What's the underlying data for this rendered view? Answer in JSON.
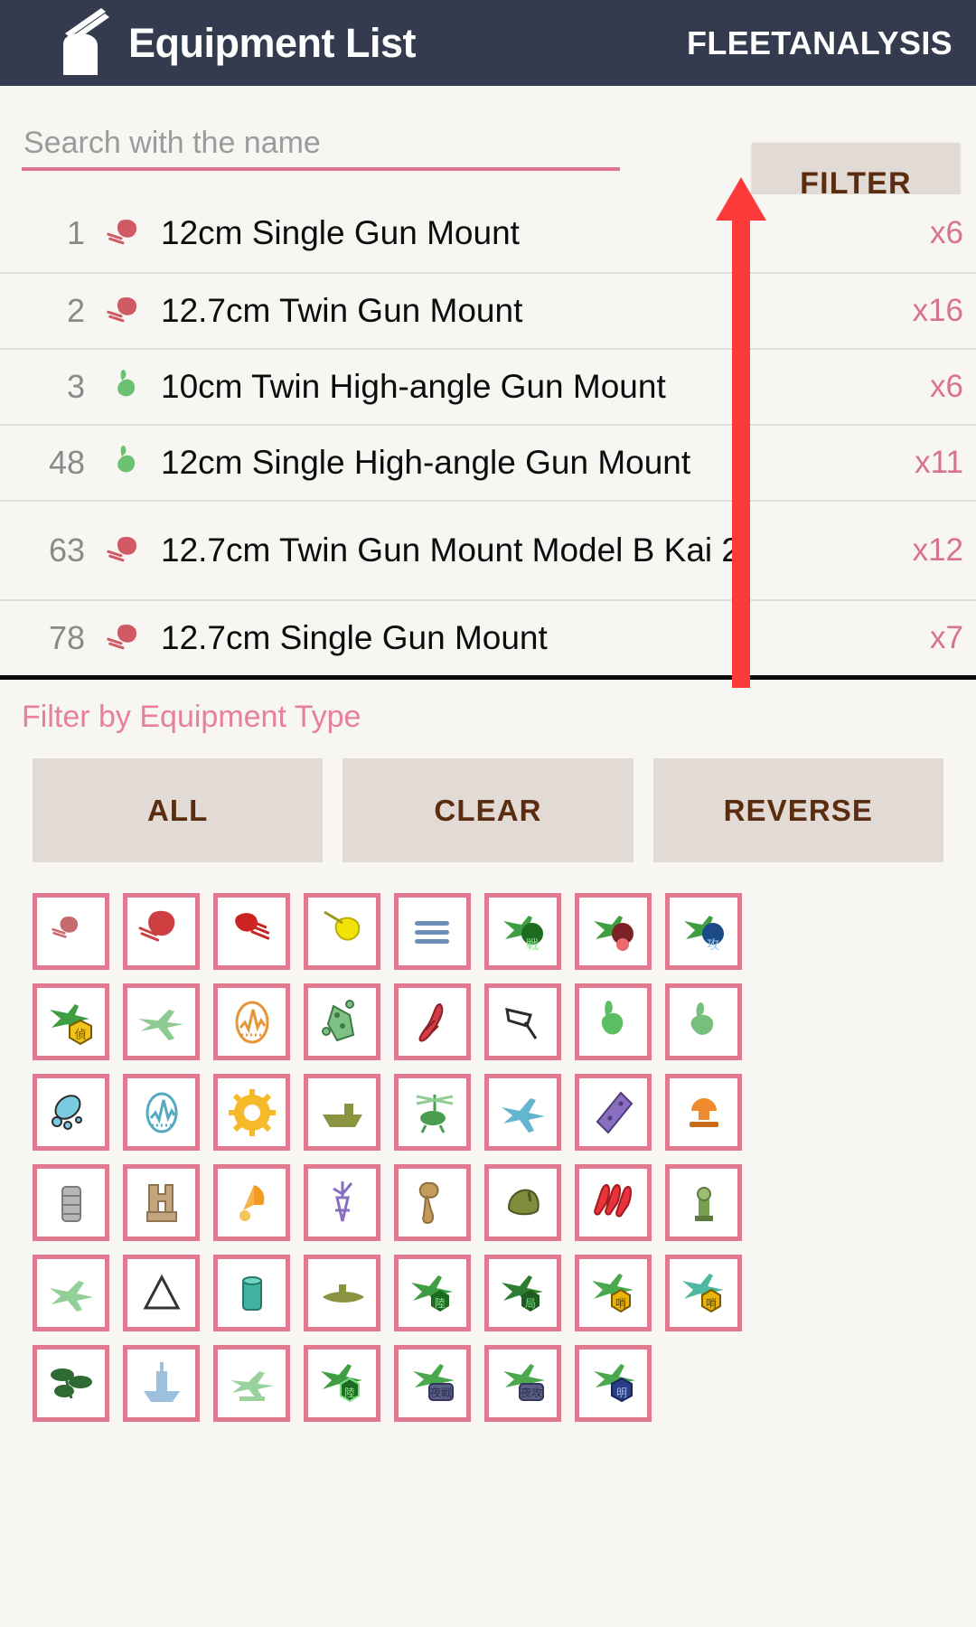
{
  "appbar": {
    "title": "Equipment List",
    "brand": "FLEETANALYSIS",
    "logo_icon": "gun-mount-icon",
    "bg_color": "#353b4e"
  },
  "search": {
    "placeholder": "Search with the name",
    "value": "",
    "underline_color": "#e0758f"
  },
  "filter_button": {
    "label": "FILTER",
    "bg_color": "#e2dad4",
    "text_color": "#5a2d10"
  },
  "equipment_list": {
    "columns": [
      "id",
      "icon",
      "name",
      "count"
    ],
    "rows": [
      {
        "id": "1",
        "icon": "red-small-gun-mount-icon",
        "name": "12cm Single Gun Mount",
        "count": "x6"
      },
      {
        "id": "2",
        "icon": "red-small-gun-mount-icon",
        "name": "12.7cm Twin Gun Mount",
        "count": "x16"
      },
      {
        "id": "3",
        "icon": "green-high-angle-gun-icon",
        "name": "10cm Twin High-angle Gun Mount",
        "count": "x6"
      },
      {
        "id": "48",
        "icon": "green-high-angle-gun-icon",
        "name": "12cm Single High-angle Gun Mount",
        "count": "x11"
      },
      {
        "id": "63",
        "icon": "red-small-gun-mount-icon",
        "name": "12.7cm Twin Gun Mount Model B Kai 2",
        "count": "x12"
      },
      {
        "id": "78",
        "icon": "red-small-gun-mount-icon",
        "name": "12.7cm Single Gun Mount",
        "count": "x7"
      }
    ],
    "count_color": "#d9738c",
    "id_color": "#8a8a8a"
  },
  "filter_panel": {
    "heading": "Filter by Equipment Type",
    "heading_color": "#e8809a",
    "actions": [
      {
        "label": "ALL",
        "name": "select-all-types-button"
      },
      {
        "label": "CLEAR",
        "name": "clear-types-button"
      },
      {
        "label": "REVERSE",
        "name": "reverse-types-button"
      }
    ],
    "cell_border_color": "#e0798f",
    "types": [
      {
        "icon": "small-caliber-main-gun-icon"
      },
      {
        "icon": "medium-caliber-main-gun-icon"
      },
      {
        "icon": "large-caliber-main-gun-icon"
      },
      {
        "icon": "yellow-secondary-gun-icon"
      },
      {
        "icon": "blue-ammo-stack-icon"
      },
      {
        "icon": "green-carrier-fighter-icon"
      },
      {
        "icon": "red-carrier-dive-bomber-icon"
      },
      {
        "icon": "blue-carrier-torpedo-bomber-icon"
      },
      {
        "icon": "yellow-recon-seaplane-icon"
      },
      {
        "icon": "pale-green-plane-icon"
      },
      {
        "icon": "orange-radar-icon"
      },
      {
        "icon": "green-depth-charge-icon"
      },
      {
        "icon": "red-torpedo-icon"
      },
      {
        "icon": "white-anti-air-gun-icon"
      },
      {
        "icon": "green-high-angle-gun-icon"
      },
      {
        "icon": "green-high-angle-gun-dark-icon"
      },
      {
        "icon": "cyan-sonar-icon"
      },
      {
        "icon": "cyan-radar-icon"
      },
      {
        "icon": "yellow-turbine-icon"
      },
      {
        "icon": "olive-landing-craft-icon"
      },
      {
        "icon": "green-autogyro-icon"
      },
      {
        "icon": "cyan-liaison-plane-icon"
      },
      {
        "icon": "purple-armor-plate-icon"
      },
      {
        "icon": "orange-searchlight-icon"
      },
      {
        "icon": "grey-drum-canister-icon"
      },
      {
        "icon": "tan-repair-facility-icon"
      },
      {
        "icon": "orange-balloon-icon"
      },
      {
        "icon": "purple-antenna-icon"
      },
      {
        "icon": "tan-wrench-icon"
      },
      {
        "icon": "olive-helmet-icon"
      },
      {
        "icon": "red-rocket-launcher-icon"
      },
      {
        "icon": "green-command-facility-icon"
      },
      {
        "icon": "pale-green-seaplane-icon"
      },
      {
        "icon": "white-ration-icon"
      },
      {
        "icon": "teal-supply-drum-icon"
      },
      {
        "icon": "olive-submarine-icon"
      },
      {
        "icon": "green-carrier-plane-badge-icon"
      },
      {
        "icon": "green-carrier-plane-badge-2-icon"
      },
      {
        "icon": "green-carrier-plane-yellow-badge-icon"
      },
      {
        "icon": "teal-carrier-plane-yellow-badge-icon"
      },
      {
        "icon": "dark-green-shrub-icon"
      },
      {
        "icon": "blue-transport-ship-icon"
      },
      {
        "icon": "pale-green-float-plane-icon"
      },
      {
        "icon": "green-plane-badge-icon"
      },
      {
        "icon": "green-night-fighter-icon"
      },
      {
        "icon": "green-night-attacker-icon"
      },
      {
        "icon": "blue-night-recon-icon"
      }
    ]
  },
  "annotation": {
    "arrow_color": "#fc3a3a",
    "arrow_points_to": "filter-button"
  }
}
